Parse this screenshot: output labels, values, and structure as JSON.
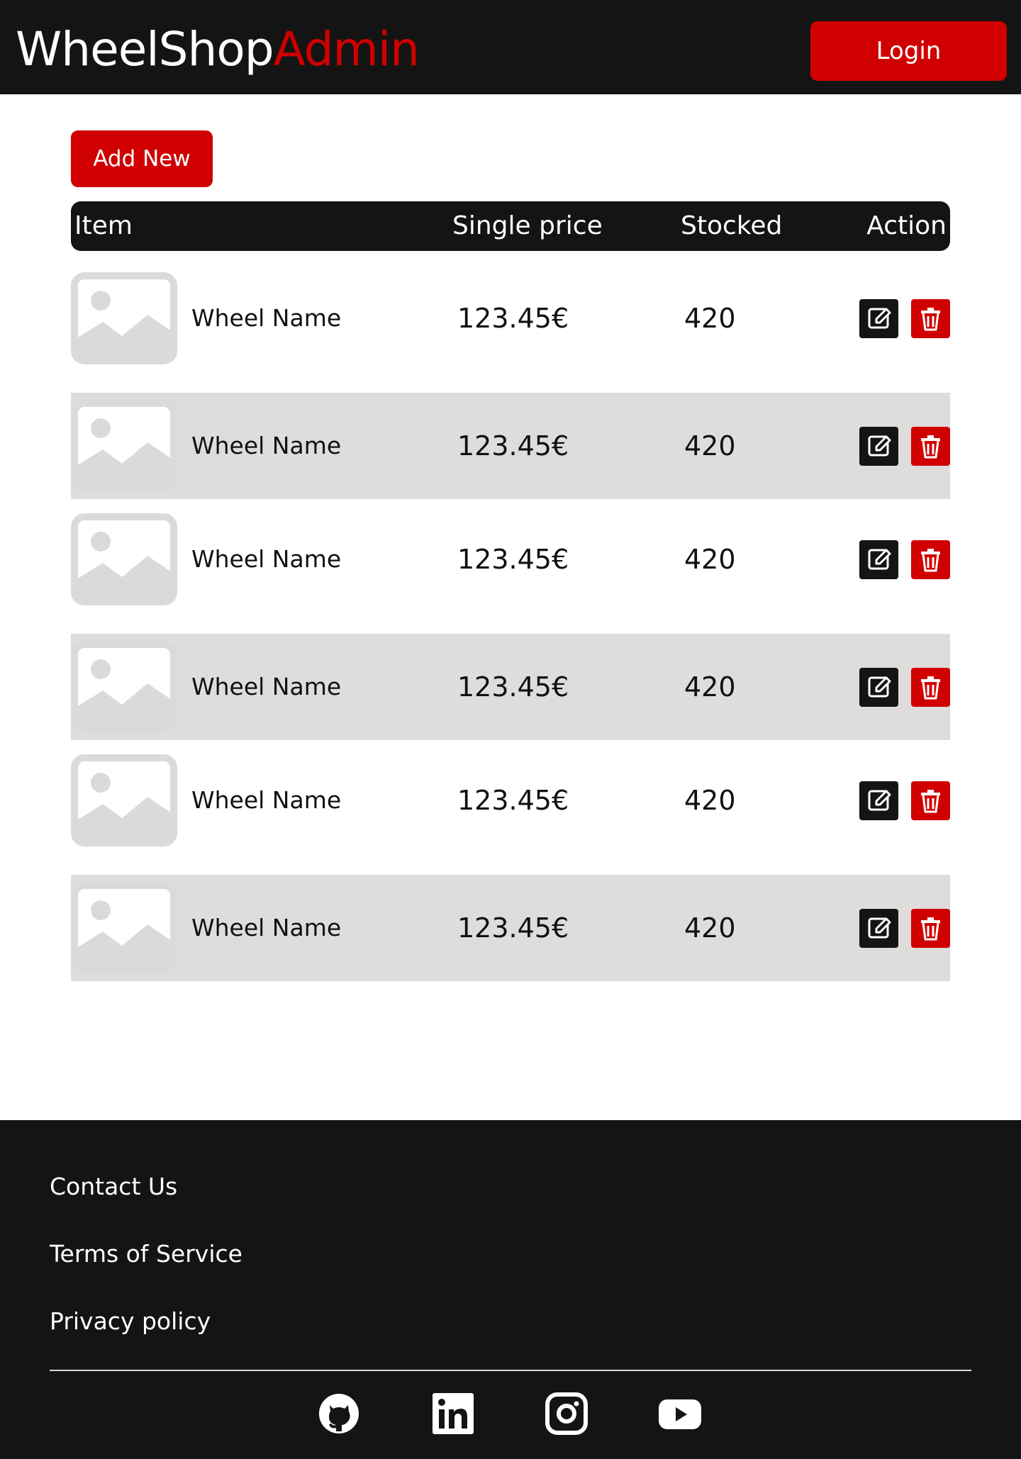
{
  "header": {
    "logo_part1": "WheelShop",
    "logo_part2": "Admin",
    "login_label": "Login"
  },
  "toolbar": {
    "add_new_label": "Add New"
  },
  "table": {
    "columns": [
      "Item",
      "Single price",
      "Stocked",
      "Action"
    ],
    "rows": [
      {
        "name": "Wheel Name",
        "price": "123.45€",
        "stocked": "420"
      },
      {
        "name": "Wheel Name",
        "price": "123.45€",
        "stocked": "420"
      },
      {
        "name": "Wheel Name",
        "price": "123.45€",
        "stocked": "420"
      },
      {
        "name": "Wheel Name",
        "price": "123.45€",
        "stocked": "420"
      },
      {
        "name": "Wheel Name",
        "price": "123.45€",
        "stocked": "420"
      },
      {
        "name": "Wheel Name",
        "price": "123.45€",
        "stocked": "420"
      }
    ]
  },
  "footer": {
    "links": [
      "Contact Us",
      "Terms of Service",
      "Privacy policy"
    ],
    "social_icons": [
      "github-icon",
      "linkedin-icon",
      "instagram-icon",
      "youtube-icon"
    ]
  },
  "colors": {
    "dark": "#151414",
    "accent": "#d00000",
    "row_alt": "#dfdcdc",
    "placeholder": "#dcd9d9"
  }
}
